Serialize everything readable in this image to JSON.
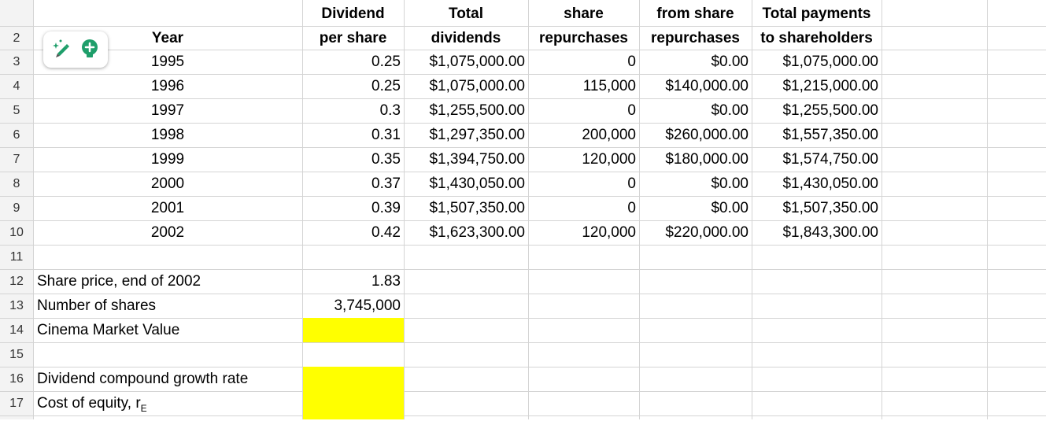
{
  "header_row1": {
    "col_c": "Dividend",
    "col_d": "Total",
    "col_e": "share",
    "col_f": "from share",
    "col_g": "Total payments"
  },
  "header_row2": {
    "col_b": "Year",
    "col_c": "per share",
    "col_d": "dividends",
    "col_e": "repurchases",
    "col_f": "repurchases",
    "col_g": "to shareholders"
  },
  "row_numbers": [
    "2",
    "3",
    "4",
    "5",
    "6",
    "7",
    "8",
    "9",
    "10",
    "11",
    "12",
    "13",
    "14",
    "15",
    "16",
    "17"
  ],
  "data_rows": [
    {
      "row": "3",
      "year": "1995",
      "dps": "0.25",
      "total_div": "$1,075,000.00",
      "shares_rep": "0",
      "amt_rep": "$0.00",
      "total_pay": "$1,075,000.00"
    },
    {
      "row": "4",
      "year": "1996",
      "dps": "0.25",
      "total_div": "$1,075,000.00",
      "shares_rep": "115,000",
      "amt_rep": "$140,000.00",
      "total_pay": "$1,215,000.00"
    },
    {
      "row": "5",
      "year": "1997",
      "dps": "0.3",
      "total_div": "$1,255,500.00",
      "shares_rep": "0",
      "amt_rep": "$0.00",
      "total_pay": "$1,255,500.00"
    },
    {
      "row": "6",
      "year": "1998",
      "dps": "0.31",
      "total_div": "$1,297,350.00",
      "shares_rep": "200,000",
      "amt_rep": "$260,000.00",
      "total_pay": "$1,557,350.00"
    },
    {
      "row": "7",
      "year": "1999",
      "dps": "0.35",
      "total_div": "$1,394,750.00",
      "shares_rep": "120,000",
      "amt_rep": "$180,000.00",
      "total_pay": "$1,574,750.00"
    },
    {
      "row": "8",
      "year": "2000",
      "dps": "0.37",
      "total_div": "$1,430,050.00",
      "shares_rep": "0",
      "amt_rep": "$0.00",
      "total_pay": "$1,430,050.00"
    },
    {
      "row": "9",
      "year": "2001",
      "dps": "0.39",
      "total_div": "$1,507,350.00",
      "shares_rep": "0",
      "amt_rep": "$0.00",
      "total_pay": "$1,507,350.00"
    },
    {
      "row": "10",
      "year": "2002",
      "dps": "0.42",
      "total_div": "$1,623,300.00",
      "shares_rep": "120,000",
      "amt_rep": "$220,000.00",
      "total_pay": "$1,843,300.00"
    }
  ],
  "labels": {
    "share_price": "Share price, end of 2002",
    "num_shares": "Number of shares",
    "market_value": "Cinema Market Value",
    "growth_rate": "Dividend compound growth rate",
    "cost_equity": "Cost of equity, r",
    "cost_equity_sub": "E"
  },
  "values": {
    "share_price": "1.83",
    "num_shares": "3,745,000"
  },
  "toolbar": {
    "pencil_icon": "sparkle-pencil-icon",
    "bulb_icon": "lightbulb-icon"
  },
  "colors": {
    "highlight": "#ffff00",
    "accent_green": "#1e9e6a"
  }
}
